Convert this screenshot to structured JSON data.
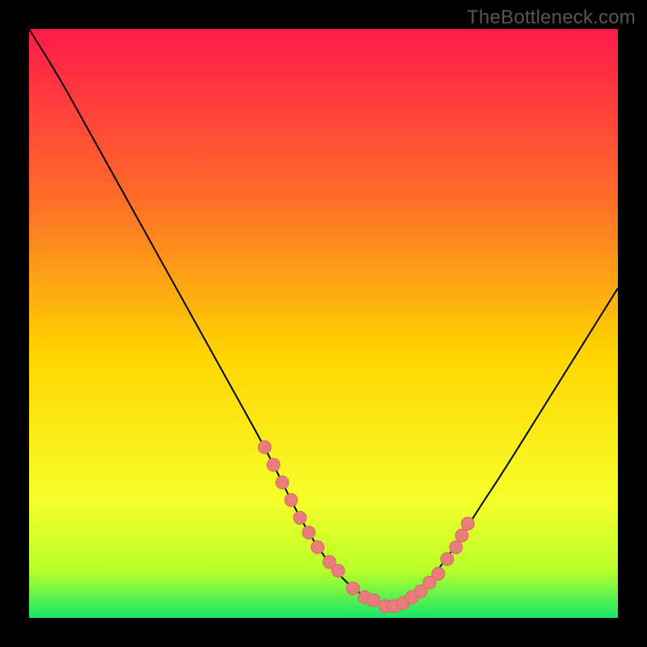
{
  "watermark": "TheBottleneck.com",
  "colors": {
    "bg": "#000000",
    "watermark": "#555555",
    "curve": "#000000",
    "dot_fill": "#e97d79",
    "dot_stroke": "#d66b68",
    "grad_top": "#ff1a4b",
    "grad_q1": "#ff6a2a",
    "grad_mid": "#ffd400",
    "grad_q3": "#f6ff2a",
    "grad_low": "#b8ff2a",
    "grad_bot": "#17e66a"
  },
  "chart_data": {
    "type": "line",
    "title": "",
    "xlabel": "",
    "ylabel": "",
    "xlim": [
      0,
      100
    ],
    "ylim": [
      0,
      100
    ],
    "series": [
      {
        "name": "bottleneck-curve",
        "x": [
          0,
          5,
          10,
          15,
          20,
          25,
          30,
          35,
          40,
          43,
          46,
          49,
          52,
          55,
          58,
          60,
          62,
          64,
          66,
          68,
          70,
          73,
          76,
          80,
          85,
          90,
          95,
          100
        ],
        "y": [
          100,
          92,
          83,
          74,
          65,
          56,
          47,
          38,
          29,
          23,
          17,
          12,
          8,
          5,
          3,
          2,
          2,
          3,
          4,
          6,
          9,
          13,
          18,
          24,
          32,
          40,
          48,
          56
        ]
      }
    ],
    "highlight_points": {
      "name": "marked-range-dots",
      "x": [
        40,
        41.5,
        43,
        44.5,
        46,
        47.5,
        49,
        51,
        52.5,
        55,
        57,
        58.5,
        60.5,
        62,
        63.5,
        65,
        66.5,
        68,
        69.5,
        71,
        72.5,
        73.5,
        74.5
      ],
      "y": [
        29,
        26,
        23,
        20,
        17,
        14.5,
        12,
        9.5,
        8,
        5,
        3.5,
        3,
        2,
        2,
        2.5,
        3.5,
        4.5,
        6,
        7.5,
        10,
        12,
        14,
        16
      ]
    },
    "gradient_stops": [
      {
        "offset": 0.0,
        "color_key": "grad_top"
      },
      {
        "offset": 0.28,
        "color_key": "grad_q1"
      },
      {
        "offset": 0.55,
        "color_key": "grad_mid"
      },
      {
        "offset": 0.8,
        "color_key": "grad_q3"
      },
      {
        "offset": 0.92,
        "color_key": "grad_low"
      },
      {
        "offset": 1.0,
        "color_key": "grad_bot"
      }
    ]
  }
}
